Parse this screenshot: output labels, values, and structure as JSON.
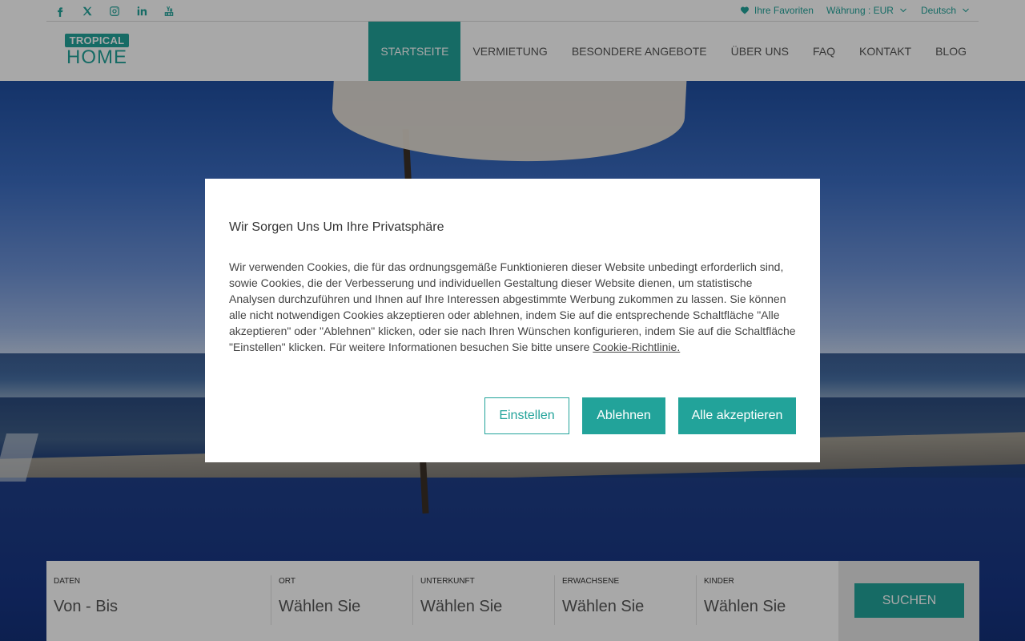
{
  "header": {
    "social": [
      "facebook-icon",
      "x-icon",
      "instagram-icon",
      "linkedin-icon",
      "youtube-icon"
    ],
    "favorites": "Ihre Favoriten",
    "currency": "Währung : EUR",
    "language": "Deutsch",
    "logo_top": "TROPICAL",
    "logo_bottom": "HOME",
    "nav": [
      "STARTSEITE",
      "VERMIETUNG",
      "BESONDERE ANGEBOTE",
      "ÜBER UNS",
      "FAQ",
      "KONTAKT",
      "BLOG"
    ],
    "active_nav": "STARTSEITE"
  },
  "modal": {
    "title": "Wir Sorgen Uns Um Ihre Privatsphäre",
    "body": "Wir verwenden Cookies, die für das ordnungsgemäße Funktionieren dieser Website unbedingt erforderlich sind, sowie Cookies, die der Verbesserung und individuellen Gestaltung dieser Website dienen, um statistische Analysen durchzuführen und Ihnen auf Ihre Interessen abgestimmte Werbung zukommen zu lassen. Sie können alle nicht notwendigen Cookies akzeptieren oder ablehnen, indem Sie auf die entsprechende Schaltfläche \"Alle akzeptieren\" oder \"Ablehnen\" klicken, oder sie nach Ihren Wünschen konfigurieren, indem Sie auf die Schaltfläche \"Einstellen\" klicken. Für weitere Informationen besuchen Sie bitte unsere",
    "link": "Cookie-Richtlinie.",
    "btn_settings": "Einstellen",
    "btn_reject": "Ablehnen",
    "btn_accept": "Alle akzeptieren"
  },
  "search": {
    "dates_label": "DATEN",
    "dates_value": "Von - Bis",
    "place_label": "ORT",
    "place_value": "Wählen Sie",
    "accommodation_label": "UNTERKUNFT",
    "accommodation_value": "Wählen Sie",
    "adults_label": "ERWACHSENE",
    "adults_value": "Wählen Sie",
    "children_label": "KINDER",
    "children_value": "Wählen Sie",
    "button": "SUCHEN"
  },
  "colors": {
    "accent": "#22a39a"
  }
}
